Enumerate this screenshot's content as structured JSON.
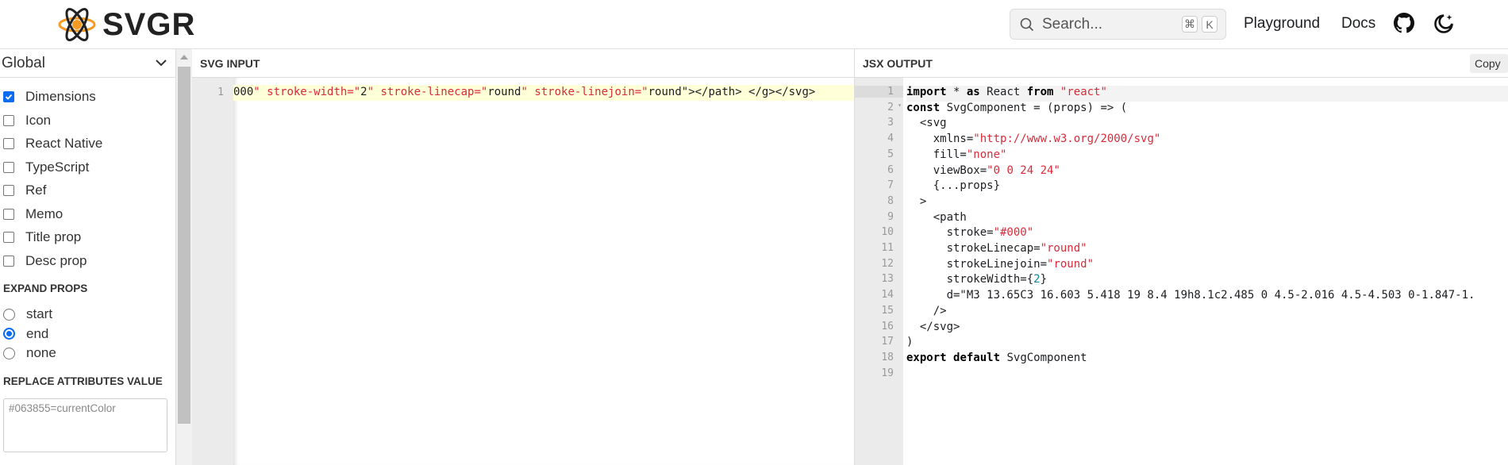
{
  "header": {
    "logo_text": "SVGR",
    "search_placeholder": "Search...",
    "search_keys": [
      "⌘",
      "K"
    ],
    "nav": [
      "Playground",
      "Docs"
    ]
  },
  "sidebar": {
    "preset": "Global",
    "options": [
      {
        "label": "Dimensions",
        "checked": true
      },
      {
        "label": "Icon",
        "checked": false
      },
      {
        "label": "React Native",
        "checked": false
      },
      {
        "label": "TypeScript",
        "checked": false
      },
      {
        "label": "Ref",
        "checked": false
      },
      {
        "label": "Memo",
        "checked": false
      },
      {
        "label": "Title prop",
        "checked": false
      },
      {
        "label": "Desc prop",
        "checked": false
      }
    ],
    "expand_props_label": "EXPAND PROPS",
    "expand_props": [
      {
        "label": "start",
        "selected": false
      },
      {
        "label": "end",
        "selected": true
      },
      {
        "label": "none",
        "selected": false
      }
    ],
    "replace_label": "REPLACE ATTRIBUTES VALUE",
    "replace_placeholder": "#063855=currentColor"
  },
  "input": {
    "title": "SVG INPUT",
    "line_number": "1",
    "line": "000\" stroke-width=\"2\" stroke-linecap=\"round\" stroke-linejoin=\"round\"></path> </g></svg>"
  },
  "output": {
    "title": "JSX OUTPUT",
    "copy_label": "Copy",
    "lines": [
      "import * as React from \"react\"",
      "const SvgComponent = (props) => (",
      "  <svg",
      "    xmlns=\"http://www.w3.org/2000/svg\"",
      "    fill=\"none\"",
      "    viewBox=\"0 0 24 24\"",
      "    {...props}",
      "  >",
      "    <path",
      "      stroke=\"#000\"",
      "      strokeLinecap=\"round\"",
      "      strokeLinejoin=\"round\"",
      "      strokeWidth={2}",
      "      d=\"M3 13.65C3 16.603 5.418 19 8.4 19h8.1c2.485 0 4.5-2.016 4.5-4.503 0-1.847-1.",
      "    />",
      "  </svg>",
      ")",
      "export default SvgComponent",
      ""
    ]
  }
}
